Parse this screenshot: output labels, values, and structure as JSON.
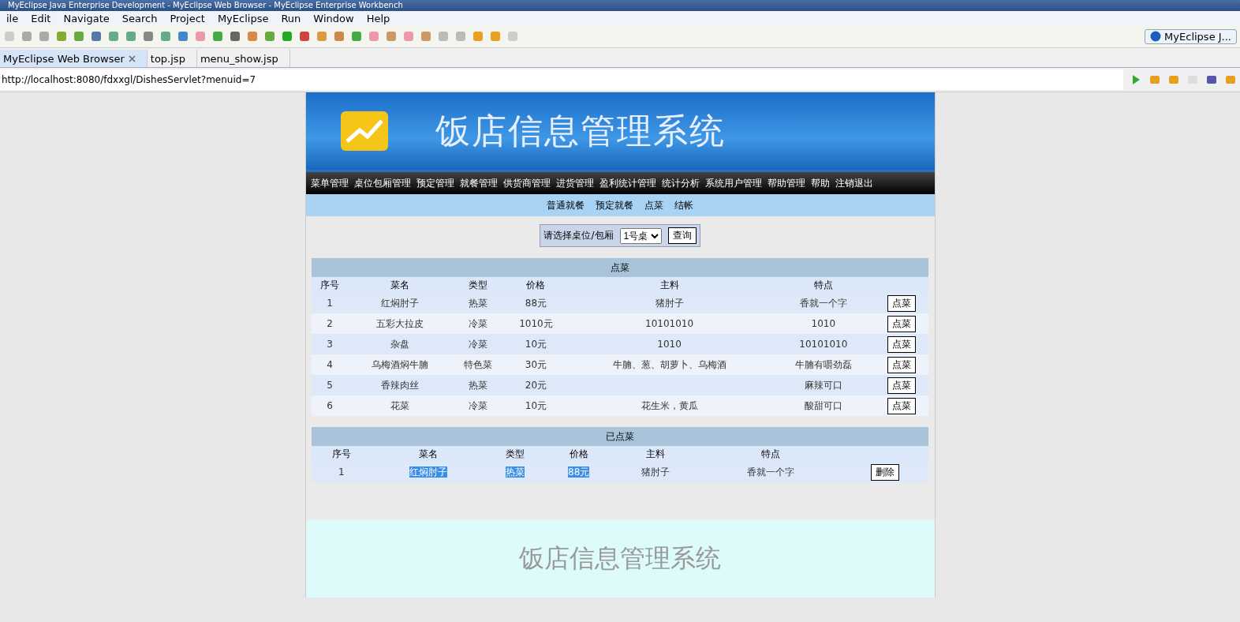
{
  "window": {
    "title": "MyEclipse Java Enterprise Development - MyEclipse Web Browser - MyEclipse Enterprise Workbench"
  },
  "menu": [
    "ile",
    "Edit",
    "Navigate",
    "Search",
    "Project",
    "MyEclipse",
    "Run",
    "Window",
    "Help"
  ],
  "perspective": {
    "label": "MyEclipse J..."
  },
  "editor_tabs": [
    {
      "label": "MyEclipse Web Browser",
      "selected": true
    },
    {
      "label": "top.jsp",
      "selected": false
    },
    {
      "label": "menu_show.jsp",
      "selected": false
    }
  ],
  "address": {
    "value": "http://localhost:8080/fdxxgl/DishesServlet?menuid=7"
  },
  "page": {
    "banner_title": "饭店信息管理系统",
    "nav": [
      "菜单管理",
      "桌位包厢管理",
      "预定管理",
      "就餐管理",
      "供货商管理",
      "进货管理",
      "盈利统计管理",
      "统计分析",
      "系统用户管理",
      "帮助管理",
      "帮助",
      "注销退出"
    ],
    "subnav": [
      "普通就餐",
      "预定就餐",
      "点菜",
      "结帐"
    ],
    "table_picker": {
      "label": "请选择桌位/包厢",
      "value": "1号桌",
      "button": "查询"
    },
    "menu_table": {
      "title": "点菜",
      "columns": [
        "序号",
        "菜名",
        "类型",
        "价格",
        "主料",
        "特点"
      ],
      "rows": [
        {
          "cells": [
            "1",
            "红焖肘子",
            "热菜",
            "88元",
            "猪肘子",
            "香就一个字"
          ],
          "action": "点菜"
        },
        {
          "cells": [
            "2",
            "五彩大拉皮",
            "冷菜",
            "1010元",
            "10101010",
            "1010"
          ],
          "action": "点菜"
        },
        {
          "cells": [
            "3",
            "杂盘",
            "冷菜",
            "10元",
            "1010",
            "10101010"
          ],
          "action": "点菜"
        },
        {
          "cells": [
            "4",
            "乌梅酒焖牛腩",
            "特色菜",
            "30元",
            "牛腩、葱、胡萝卜、乌梅酒",
            "牛腩有嚼劲磊"
          ],
          "action": "点菜"
        },
        {
          "cells": [
            "5",
            "香辣肉丝",
            "热菜",
            "20元",
            "",
            "麻辣可口"
          ],
          "action": "点菜"
        },
        {
          "cells": [
            "6",
            "花菜",
            "冷菜",
            "10元",
            "花生米，黄瓜",
            "酸甜可口"
          ],
          "action": "点菜"
        }
      ]
    },
    "ordered_table": {
      "title": "已点菜",
      "columns": [
        "序号",
        "菜名",
        "类型",
        "价格",
        "主料",
        "特点"
      ],
      "rows": [
        {
          "cells": [
            "1",
            "红焖肘子",
            "热菜",
            "88元",
            "猪肘子",
            "香就一个字"
          ],
          "highlighted": [
            false,
            true,
            true,
            true,
            false,
            false
          ],
          "action": "删除"
        }
      ]
    },
    "footer_title": "饭店信息管理系统"
  }
}
